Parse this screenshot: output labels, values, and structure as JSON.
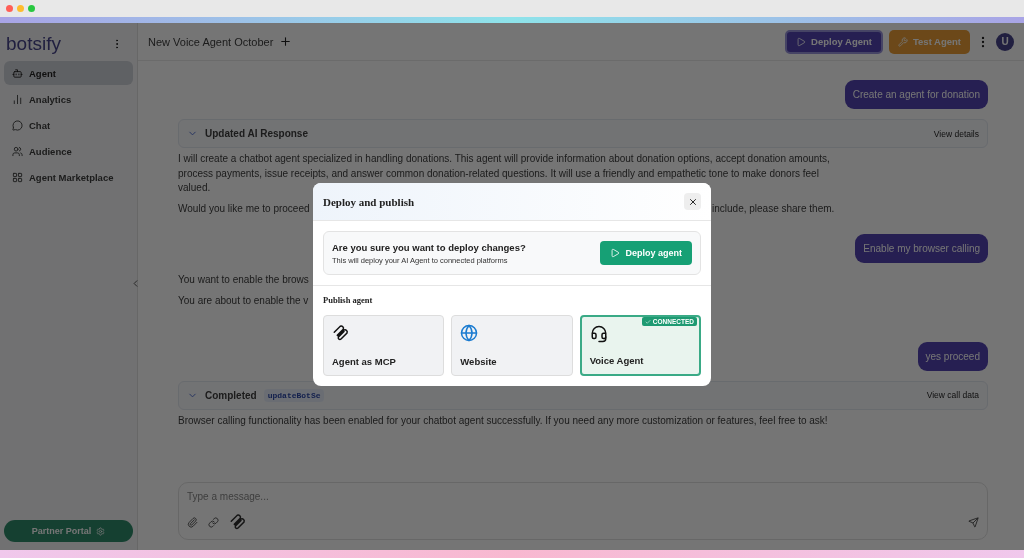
{
  "sidebar": {
    "logo": "botsify",
    "items": [
      {
        "label": "Agent",
        "selected": true
      },
      {
        "label": "Analytics",
        "selected": false
      },
      {
        "label": "Chat",
        "selected": false
      },
      {
        "label": "Audience",
        "selected": false
      },
      {
        "label": "Agent Marketplace",
        "selected": false
      }
    ],
    "partner_button": "Partner Portal"
  },
  "header": {
    "title": "New Voice Agent October",
    "buttons": [
      {
        "label": "Deploy Agent",
        "kind": "deploy"
      },
      {
        "label": "Test Agent",
        "kind": "test"
      }
    ],
    "avatar": "U"
  },
  "chat": {
    "messages": [
      {
        "kind": "user",
        "text": "Create an agent for donation"
      },
      {
        "kind": "step",
        "title": "Updated AI Response",
        "link": "View details"
      },
      {
        "kind": "text",
        "lines": [
          "I will create a chatbot agent specialized in handling donations. This agent will provide information about donation options, accept donation amounts, process payments, issue receipts, and answer common donation-related questions. It will use a friendly and empathetic tone to make donors feel valued."
        ]
      },
      {
        "kind": "split",
        "left": "Would you like me to proceed",
        "right": "include, please share them."
      },
      {
        "kind": "user",
        "text": "Enable my browser calling"
      },
      {
        "kind": "text",
        "lines": [
          "You want to enable the brows",
          "You are about to enable the v"
        ]
      },
      {
        "kind": "user",
        "text": "yes proceed"
      },
      {
        "kind": "step",
        "title": "Completed",
        "tag": "updateBotSe",
        "link": "View call data"
      },
      {
        "kind": "text",
        "lines": [
          "Browser calling functionality has been enabled for your chatbot agent successfully. If you need any more customization or features, feel free to ask!"
        ]
      }
    ]
  },
  "composer": {
    "placeholder": "Type a message..."
  },
  "modal": {
    "title": "Deploy and publish",
    "confirm": {
      "heading": "Are you sure you want to deploy changes?",
      "text": "This will deploy your AI Agent to connected platforms",
      "button": "Deploy agent"
    },
    "section": "Publish agent",
    "cards": [
      {
        "label": "Agent as MCP",
        "connected": false
      },
      {
        "label": "Website",
        "connected": false
      },
      {
        "label": "Voice Agent",
        "connected": true,
        "badge": "CONNECTED"
      }
    ]
  }
}
